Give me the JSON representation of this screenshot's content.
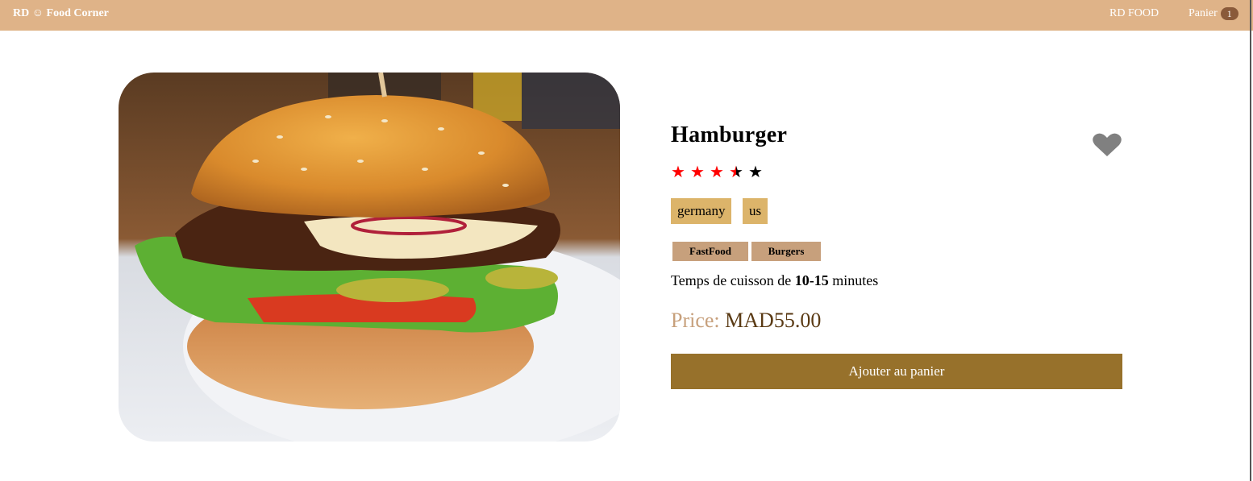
{
  "header": {
    "brand": "RD ☺ Food Corner",
    "nav": {
      "rdfood": "RD FOOD",
      "cart": "Panier",
      "cart_count": "1"
    }
  },
  "product": {
    "name": "Hamburger",
    "rating": 3.5,
    "stars_total": 5,
    "origins": [
      "germany",
      "us"
    ],
    "tags": [
      "FastFood",
      "Burgers"
    ],
    "cook_time_prefix": "Temps de cuisson de",
    "cook_time_value": "10-15",
    "cook_time_suffix": "minutes",
    "price_label": "Price:",
    "price_value": "MAD55.00",
    "add_button": "Ajouter au panier"
  },
  "colors": {
    "header_bg": "#dfb388",
    "star_filled": "#ff0000",
    "star_empty": "#000000",
    "origin_bg": "#dcb46a",
    "tag_bg": "#c7a07c",
    "button_bg": "#97712b",
    "heart": "#808080"
  },
  "icons": {
    "favorite": "heart-icon",
    "rating": "star-icon"
  }
}
